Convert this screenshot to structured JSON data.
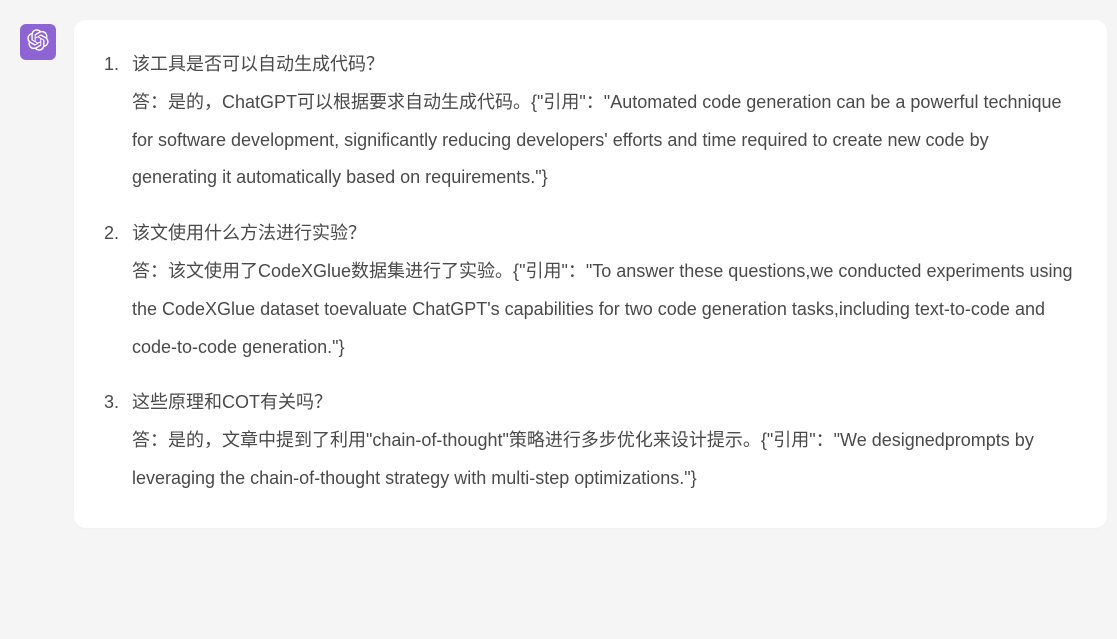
{
  "avatar": {
    "label": "openai-logo"
  },
  "items": [
    {
      "question": "该工具是否可以自动生成代码？",
      "answer": "答：是的，ChatGPT可以根据要求自动生成代码。{\"引用\"：\"Automated code generation can be a powerful technique for software development, significantly reducing developers' efforts and time required to create new code by generating it automatically based on requirements.\"}"
    },
    {
      "question": "该文使用什么方法进行实验？",
      "answer": "答：该文使用了CodeXGlue数据集进行了实验。{\"引用\"：\"To answer these questions,we conducted experiments using the CodeXGlue dataset toevaluate ChatGPT's capabilities for two code generation tasks,including text-to-code and code-to-code generation.\"}"
    },
    {
      "question": "这些原理和COT有关吗？",
      "answer": "答：是的，文章中提到了利用\"chain-of-thought\"策略进行多步优化来设计提示。{\"引用\"：\"We designedprompts by leveraging the chain-of-thought strategy with multi-step optimizations.\"}"
    }
  ]
}
